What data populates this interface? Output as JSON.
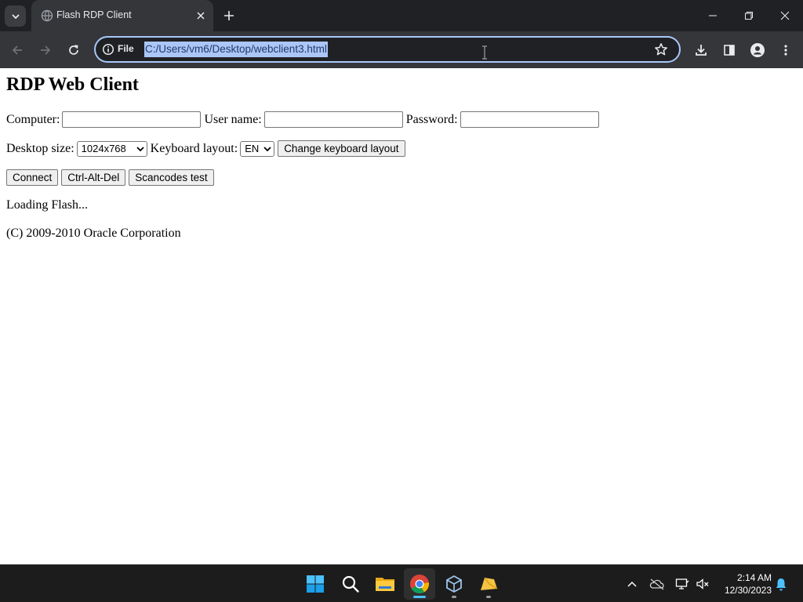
{
  "browser": {
    "tab": {
      "title": "Flash RDP Client"
    },
    "address_bar": {
      "scheme_label": "File",
      "url": "C:/Users/vm6/Desktop/webclient3.html"
    }
  },
  "page": {
    "title": "RDP Web Client",
    "login_row": {
      "computer_label": "Computer:",
      "computer_value": "",
      "username_label": "User name:",
      "username_value": "",
      "password_label": "Password:",
      "password_value": ""
    },
    "settings_row": {
      "desktop_size_label": "Desktop size:",
      "desktop_size_selected": "1024x768",
      "keyboard_layout_label": "Keyboard layout:",
      "keyboard_layout_selected": "EN",
      "change_keyboard_button": "Change keyboard layout"
    },
    "action_buttons": {
      "connect": "Connect",
      "ctrl_alt_del": "Ctrl-Alt-Del",
      "scancodes_test": "Scancodes test"
    },
    "status_text": "Loading Flash...",
    "copyright": "(C) 2009-2010 Oracle Corporation"
  },
  "taskbar": {
    "apps": [
      "start-icon",
      "search-icon",
      "file-explorer-icon",
      "chrome-icon",
      "virtualbox-icon",
      "app-icon"
    ],
    "clock": {
      "time": "2:14 AM",
      "date": "12/30/2023"
    }
  },
  "colors": {
    "browser_frame": "#202124",
    "toolbar": "#35363a",
    "url_selection": "#acc6f7",
    "taskbar": "#1c1c1c"
  }
}
